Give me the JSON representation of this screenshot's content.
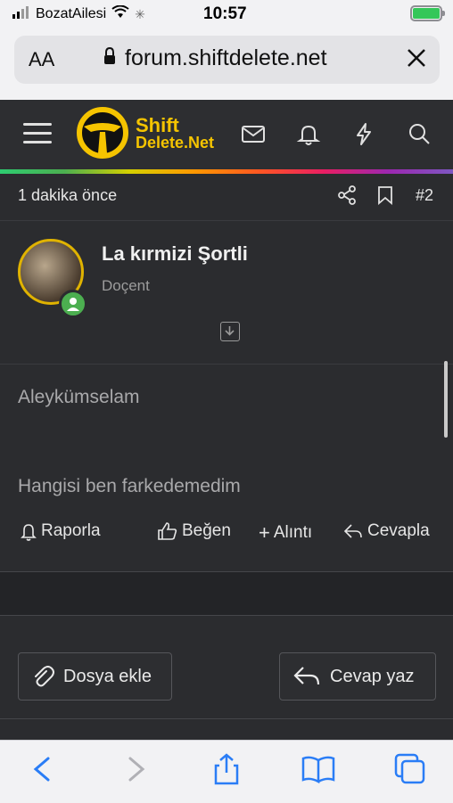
{
  "status": {
    "carrier": "BozatAilesi",
    "time": "10:57"
  },
  "browser": {
    "aa_label": "AA",
    "url": "forum.shiftdelete.net"
  },
  "site": {
    "logo_line1": "Shift",
    "logo_line2": "Delete.Net"
  },
  "post": {
    "time_ago": "1 dakika önce",
    "number": "#2",
    "username": "La kırmizi Şortli",
    "role": "Doçent",
    "lines": [
      "Aleykümselam",
      "Hangisi ben farkedemedim"
    ],
    "actions": {
      "report": "Raporla",
      "like": "Beğen",
      "quote": "Alıntı",
      "reply": "Cevapla"
    }
  },
  "composer": {
    "attach_label": "Dosya ekle",
    "reply_label": "Cevap yaz"
  },
  "colors": {
    "accent": "#f5c400",
    "online": "#4caf50",
    "ios_blue": "#2a7df6"
  }
}
